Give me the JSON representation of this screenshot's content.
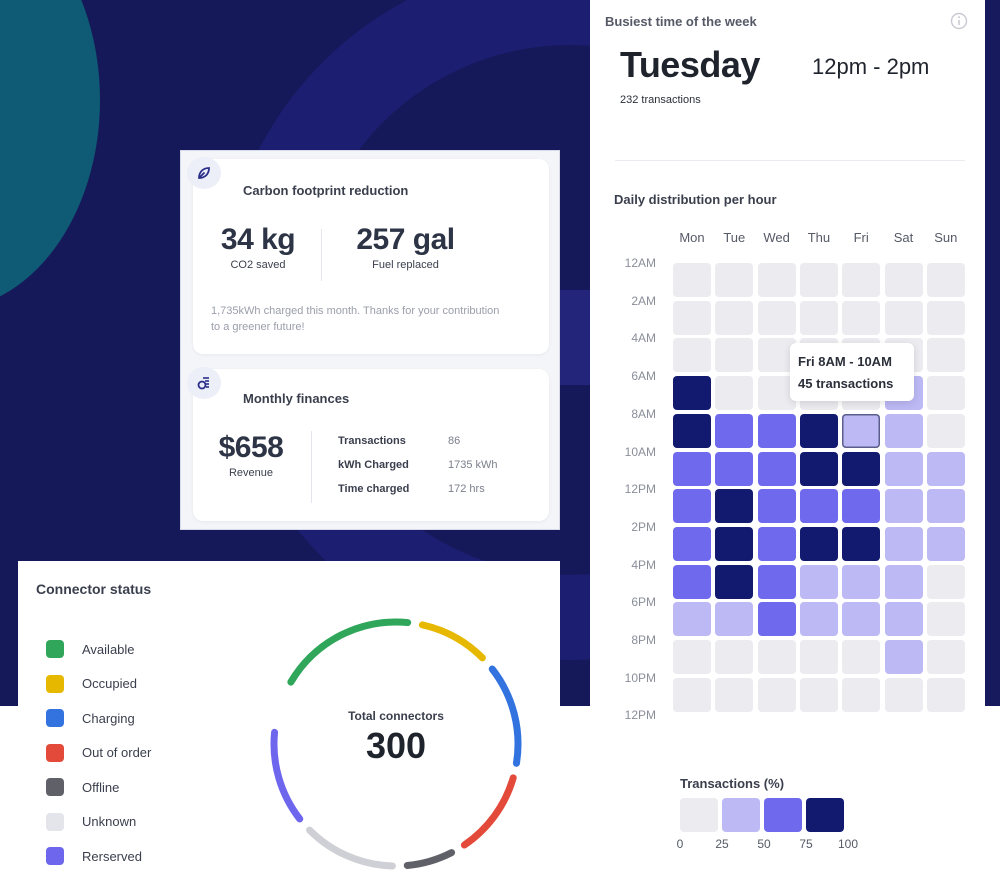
{
  "carbon": {
    "title": "Carbon footprint reduction",
    "icon": "leaf-drop-icon",
    "co2_value": "34 kg",
    "co2_label": "CO2 saved",
    "fuel_value": "257 gal",
    "fuel_label": "Fuel replaced",
    "note": "1,735kWh charged this month. Thanks for your contribution to a greener future!"
  },
  "finances": {
    "title": "Monthly finances",
    "icon": "coins-icon",
    "revenue_value": "$658",
    "revenue_label": "Revenue",
    "rows": [
      {
        "key": "Transactions",
        "value": "86"
      },
      {
        "key": "kWh Charged",
        "value": "1735 kWh"
      },
      {
        "key": "Time charged",
        "value": "172 hrs"
      }
    ]
  },
  "busiest": {
    "title": "Busiest time of the week",
    "icon": "info-icon",
    "day": "Tuesday",
    "time_range": "12pm - 2pm",
    "transactions": "232 transactions",
    "distribution_title": "Daily distribution per hour"
  },
  "chart_data": {
    "type": "heatmap",
    "title": "Daily distribution per hour",
    "x": [
      "Mon",
      "Tue",
      "Wed",
      "Thu",
      "Fri",
      "Sat",
      "Sun"
    ],
    "y_tick_labels": [
      "12AM",
      "2AM",
      "4AM",
      "6AM",
      "8AM",
      "10AM",
      "12PM",
      "2PM",
      "4PM",
      "6PM",
      "8PM",
      "10PM",
      "12PM"
    ],
    "y_bins": [
      "12AM-2AM",
      "2AM-4AM",
      "4AM-6AM",
      "6AM-8AM",
      "8AM-10AM",
      "10AM-12PM",
      "12PM-2PM",
      "2PM-4PM",
      "4PM-6PM",
      "6PM-8PM",
      "8PM-10PM",
      "10PM-12AM"
    ],
    "levels": [
      [
        0,
        0,
        0,
        0,
        0,
        0,
        0
      ],
      [
        0,
        0,
        0,
        0,
        0,
        0,
        0
      ],
      [
        0,
        0,
        0,
        0,
        0,
        0,
        0
      ],
      [
        3,
        0,
        0,
        0,
        0,
        1,
        0
      ],
      [
        3,
        2,
        2,
        3,
        1,
        1,
        0
      ],
      [
        2,
        2,
        2,
        3,
        3,
        1,
        1
      ],
      [
        2,
        3,
        2,
        2,
        2,
        1,
        1
      ],
      [
        2,
        3,
        2,
        3,
        3,
        1,
        1
      ],
      [
        2,
        3,
        2,
        1,
        1,
        1,
        0
      ],
      [
        1,
        1,
        2,
        1,
        1,
        1,
        0
      ],
      [
        0,
        0,
        0,
        0,
        0,
        1,
        0
      ],
      [
        0,
        0,
        0,
        0,
        0,
        0,
        0
      ]
    ],
    "level_meaning": "0: 0-25%, 1: 25-50%, 2: 50-75%, 3: 75-100% of transactions",
    "highlight": {
      "day": "Fri",
      "bin": "8AM-10AM"
    },
    "tooltip": {
      "line1": "Fri 8AM - 10AM",
      "line2": "45 transactions"
    },
    "legend": {
      "title": "Transactions (%)",
      "ticks": [
        "0",
        "25",
        "50",
        "75",
        "100"
      ],
      "colors": [
        "#ebebf0",
        "#bdb9f5",
        "#6f69ee",
        "#121a70"
      ]
    }
  },
  "connectors": {
    "title": "Connector status",
    "total_label": "Total connectors",
    "total": "300",
    "statuses": [
      {
        "label": "Available",
        "color": "#2fa65a"
      },
      {
        "label": "Occupied",
        "color": "#e6b800"
      },
      {
        "label": "Charging",
        "color": "#3273e0"
      },
      {
        "label": "Out of order",
        "color": "#e34a3a"
      },
      {
        "label": "Offline",
        "color": "#5f6068"
      },
      {
        "label": "Unknown",
        "color": "#e4e5ea"
      },
      {
        "label": "Rerserved",
        "color": "#6f66ee"
      }
    ],
    "ring_segments": [
      {
        "status": "Available",
        "color": "#2fa65a",
        "fraction": 0.2
      },
      {
        "status": "Occupied",
        "color": "#e6b800",
        "fraction": 0.11
      },
      {
        "status": "Charging",
        "color": "#3273e0",
        "fraction": 0.15
      },
      {
        "status": "Out of order",
        "color": "#e34a3a",
        "fraction": 0.13
      },
      {
        "status": "Offline",
        "color": "#5f6068",
        "fraction": 0.08
      },
      {
        "status": "Unknown",
        "color": "#cfd0d6",
        "fraction": 0.14
      },
      {
        "status": "Rerserved",
        "color": "#6f66ee",
        "fraction": 0.14
      }
    ]
  }
}
